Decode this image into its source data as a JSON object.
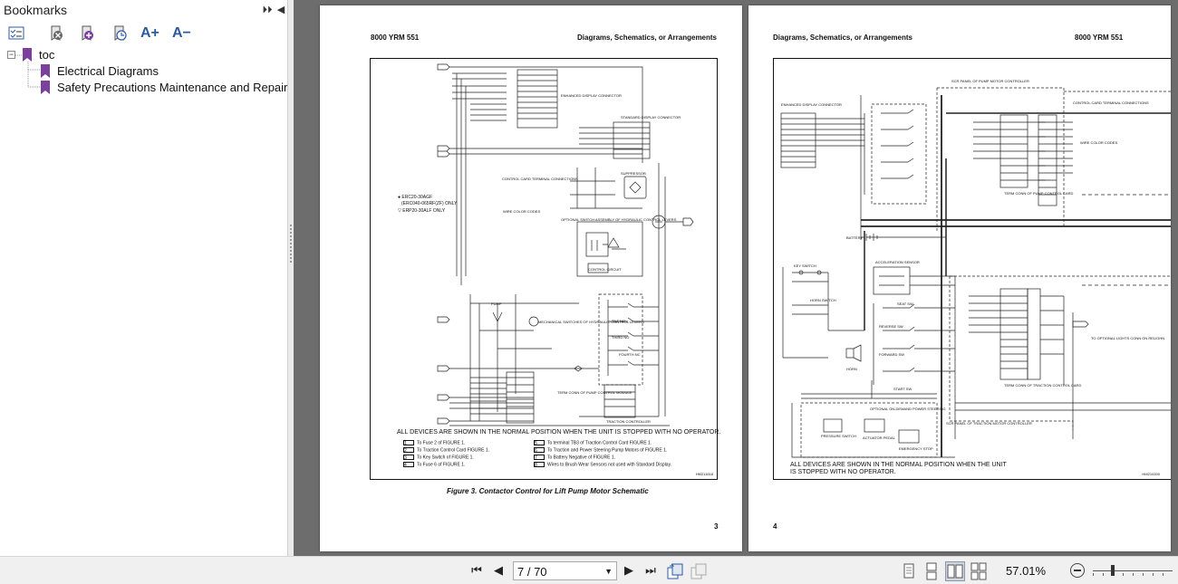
{
  "sidebar": {
    "title": "Bookmarks",
    "toolbar_icons": [
      "bookmark-options-icon",
      "delete-bookmark-icon",
      "add-bookmark-icon",
      "new-bookmark-icon",
      "increase-text-size-icon",
      "decrease-text-size-icon"
    ],
    "toolbar_labels": {
      "increase": "A+",
      "decrease": "A−"
    },
    "collapse_glyph": "⏵⏵",
    "hide_glyph": "◀",
    "tree": {
      "root_label": "toc",
      "expander": "−",
      "items": [
        {
          "label": "Electrical Diagrams"
        },
        {
          "label": "Safety Precautions Maintenance and Repair"
        }
      ]
    }
  },
  "page_left": {
    "header_left": "8000 YRM 551",
    "header_right": "Diagrams, Schematics, or Arrangements",
    "legend_1": "● ERC20-30AGF",
    "legend_1b": "(ERC040-065RF(ZF) ONLY",
    "legend_2": "▽ ERP20-30ALF ONLY",
    "normal_note": "ALL DEVICES ARE SHOWN IN THE NORMAL POSITION WHEN THE UNIT IS STOPPED WITH NO OPERATOR.",
    "refs": [
      {
        "tag": "1",
        "text": "To Fuse 2 of FIGURE 1."
      },
      {
        "tag": "2",
        "text": "To Traction Control Card FIGURE 1."
      },
      {
        "tag": "3",
        "text": "To Key Switch of FIGURE 1."
      },
      {
        "tag": "4",
        "text": "To Fuse 6 of FIGURE 1."
      },
      {
        "tag": "5",
        "text": "To terminal TB3 of Traction Control Card FIGURE 1."
      },
      {
        "tag": "6",
        "text": "To Traction and Power Steering Pump Motors of FIGURE 1."
      },
      {
        "tag": "7",
        "text": "To Battery Negative of FIGURE 1."
      },
      {
        "tag": "8",
        "text": "Wires to Brush Wear Sensors not used with Standard Display."
      }
    ],
    "drawing_code": "HM211618",
    "caption": "Figure 3. Contactor Control for Lift Pump Motor Schematic",
    "page_number": "3",
    "labels": {
      "enhanced_display": "ENHANCED DISPLAY CONNECTOR",
      "standard_display": "STANDARD DISPLAY CONNECTOR",
      "control_card": "CONTROL CARD TERMINAL CONNECTIONS",
      "wire_color_codes": "WIRE COLOR CODES",
      "suppressor": "SUPPRESSOR",
      "optional_switch": "OPTIONAL SWITCH ASSEMBLY OF HYDRAULIC CONTROL LEVERS",
      "control_circuit": "CONTROL CIRCUIT",
      "mechanical_switches": "MECHANICAL SWITCHES OF HYDRAULIC CONTROL LEVERS",
      "pump": "PUMP",
      "tilt_no": "TILT NO",
      "fourth_nc": "FOURTH NC",
      "third_no": "THIRD NO",
      "term_conn": "TERM CONN OF PUMP CONTROL MODULE",
      "traction_controller": "TRACTION CONTROLLER"
    }
  },
  "page_right": {
    "header_left": "Diagrams, Schematics, or Arrangements",
    "header_right": "8000 YRM 551",
    "normal_note_1": "ALL DEVICES ARE SHOWN IN THE NORMAL POSITION WHEN THE UNIT",
    "normal_note_2": "IS STOPPED WITH NO OPERATOR.",
    "drawing_code": "HM210200",
    "page_number": "4",
    "labels": {
      "scr_panel_top": "SCR PANEL OF PUMP MOTOR CONTROLLER",
      "enhanced_display": "ENHANCED DISPLAY CONNECTOR",
      "control_card": "CONTROL CARD TERMINAL CONNECTIONS",
      "wire_color_codes": "WIRE COLOR CODES",
      "battery": "BATTERY",
      "key_switch": "KEY SWITCH",
      "horn_switch": "HORN SWITCH",
      "horn": "HORN",
      "accel_sensor": "ACCELERATION SENSOR",
      "seat_sw": "SEAT SW",
      "reverse_sw": "REVERSE SW",
      "forward_sw": "FORWARD SW",
      "start_sw": "START SW",
      "optional_on_demand": "OPTIONAL ON-DEMAND POWER STEERING",
      "pressure_switch": "PRESSURE SWITCH",
      "actuator_pedal": "ACTUATOR PEDAL",
      "emergency_stop": "EMERGENCY STOP",
      "scr_panel_bottom": "SCR PANEL OF TRACTION MOTOR CONTROLLER",
      "optional_lights": "TO OPTIONAL LIGHTS CONN ON RELIGHN",
      "term_conn_pump": "TERM CONN OF PUMP CONTROL CARD",
      "term_conn_traction": "TERM CONN OF TRACTION CONTROL CARD"
    }
  },
  "bottombar": {
    "page_value": "7 / 70",
    "zoom": "57.01%",
    "nav": {
      "first": "⏮",
      "prev": "◀",
      "next": "▶",
      "last": "⏭"
    },
    "dropdown_arrow": "▼"
  },
  "colors": {
    "doc_bg": "#6d6d6d",
    "bookmark_purple": "#7b3f9e",
    "panel_bg": "#f0f0f0"
  }
}
